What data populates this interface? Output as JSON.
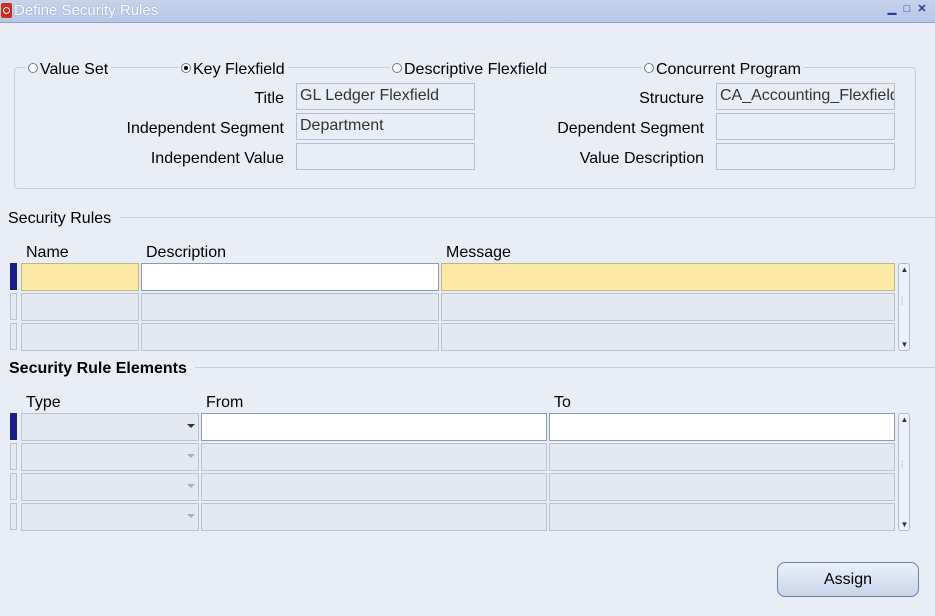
{
  "window": {
    "title": "Define Security Rules"
  },
  "type_options": {
    "value_set": "Value Set",
    "key_flexfield": "Key Flexfield",
    "descriptive_flexfield": "Descriptive Flexfield",
    "concurrent_program": "Concurrent Program",
    "selected": "key_flexfield"
  },
  "header_fields": {
    "title_label": "Title",
    "title_value": "GL Ledger Flexfield",
    "structure_label": "Structure",
    "structure_value": "CA_Accounting_Flexfield",
    "independent_segment_label": "Independent Segment",
    "independent_segment_value": "Department",
    "dependent_segment_label": "Dependent Segment",
    "dependent_segment_value": "",
    "independent_value_label": "Independent Value",
    "independent_value_value": "",
    "value_description_label": "Value Description",
    "value_description_value": ""
  },
  "security_rules": {
    "heading": "Security Rules",
    "columns": [
      "Name",
      "Description",
      "Message"
    ],
    "rows": [
      {
        "name": "",
        "description": "",
        "message": ""
      },
      {
        "name": "",
        "description": "",
        "message": ""
      },
      {
        "name": "",
        "description": "",
        "message": ""
      }
    ]
  },
  "security_rule_elements": {
    "heading": "Security Rule Elements",
    "columns": [
      "Type",
      "From",
      "To"
    ],
    "rows": [
      {
        "type": "",
        "from": "",
        "to": ""
      },
      {
        "type": "",
        "from": "",
        "to": ""
      },
      {
        "type": "",
        "from": "",
        "to": ""
      },
      {
        "type": "",
        "from": "",
        "to": ""
      }
    ]
  },
  "buttons": {
    "assign": "Assign"
  },
  "colors": {
    "title_bar": "#b5c6e6",
    "background": "#e9eef6",
    "required_field": "#fce9a6",
    "record_indicator": "#1c1f87"
  }
}
